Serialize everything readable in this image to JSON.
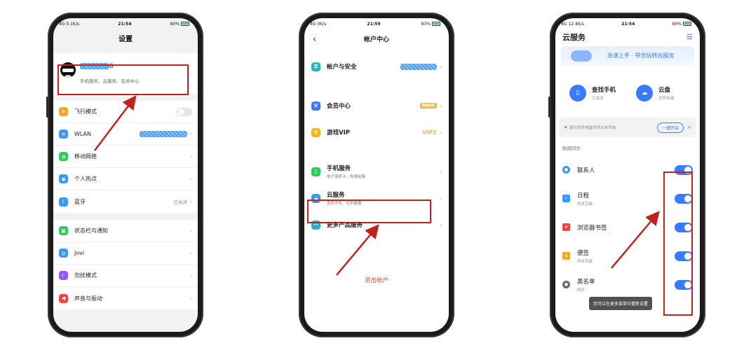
{
  "colors": {
    "highlight": "#c0231e",
    "accent": "#3a7bfd",
    "warn": "#e23b3b"
  },
  "phone1": {
    "status": {
      "left": "4G",
      "speed": "0.1K/s",
      "time": "21:54",
      "battery": "80%"
    },
    "title": "设置",
    "profile": {
      "name_suffix": "6",
      "subtitle": "手机服务、云服务、会员中心"
    },
    "group1": [
      {
        "label": "飞行模式",
        "icon": "airplane-icon",
        "color": "#f5a623"
      },
      {
        "label": "WLAN",
        "icon": "wifi-icon",
        "color": "#3a98f5"
      },
      {
        "label": "移动网络",
        "icon": "globe-icon",
        "color": "#34c759"
      },
      {
        "label": "个人热点",
        "icon": "hotspot-icon",
        "color": "#3a98f5"
      },
      {
        "label": "蓝牙",
        "icon": "bluetooth-icon",
        "color": "#3a98f5",
        "value": "已关闭"
      }
    ],
    "group2": [
      {
        "label": "状态栏与通知",
        "icon": "notification-icon",
        "color": "#34c759"
      },
      {
        "label": "Jovi",
        "icon": "jovi-icon",
        "color": "#3a98f5"
      },
      {
        "label": "勿扰模式",
        "icon": "moon-icon",
        "color": "#8e5cf5"
      },
      {
        "label": "声音与振动",
        "icon": "speaker-icon",
        "color": "#ef4444"
      }
    ]
  },
  "phone2": {
    "status": {
      "left": "4G",
      "speed": "0K/s",
      "time": "21:59",
      "battery": "83%"
    },
    "title": "帐户中心",
    "rows": {
      "security": "帐户与安全",
      "member": "会员中心",
      "member_badge": "黄金会员",
      "game": "游戏VIP",
      "game_badge": "VIP1",
      "phone_service": "手机服务",
      "phone_service_sub": "电子保修卡、免费贴膜",
      "cloud": "云服务",
      "cloud_sub": "查找手机、同步数据",
      "more": "更多产品服务"
    },
    "logout": "退出帐户"
  },
  "phone3": {
    "status": {
      "left": "4G",
      "speed": "12.4K/s",
      "time": "21:54",
      "battery": "80%"
    },
    "title": "云服务",
    "banner": "急速上手 · 带您玩转云服务",
    "tiles": [
      {
        "title": "查找手机",
        "sub": "已关闭",
        "color": "#3a7bfd"
      },
      {
        "title": "云盘",
        "sub": "文件存储",
        "color": "#3a7bfd"
      }
    ],
    "notice": {
      "text": "部分同步或备份开关未开启",
      "button": "一键开启"
    },
    "section": "数据同步",
    "sync": [
      {
        "label": "联系人",
        "sub": "",
        "color": "#3a98f5"
      },
      {
        "label": "日程",
        "sub": "同步完成",
        "color": "#3a98f5"
      },
      {
        "label": "浏览器书签",
        "sub": "",
        "color": "#ef4444"
      },
      {
        "label": "便签",
        "sub": "同步完成",
        "color": "#f5a623"
      },
      {
        "label": "黑名单",
        "sub": "同步",
        "color": "#666666"
      }
    ],
    "toast": "您可以在更多菜单中重新设置"
  }
}
